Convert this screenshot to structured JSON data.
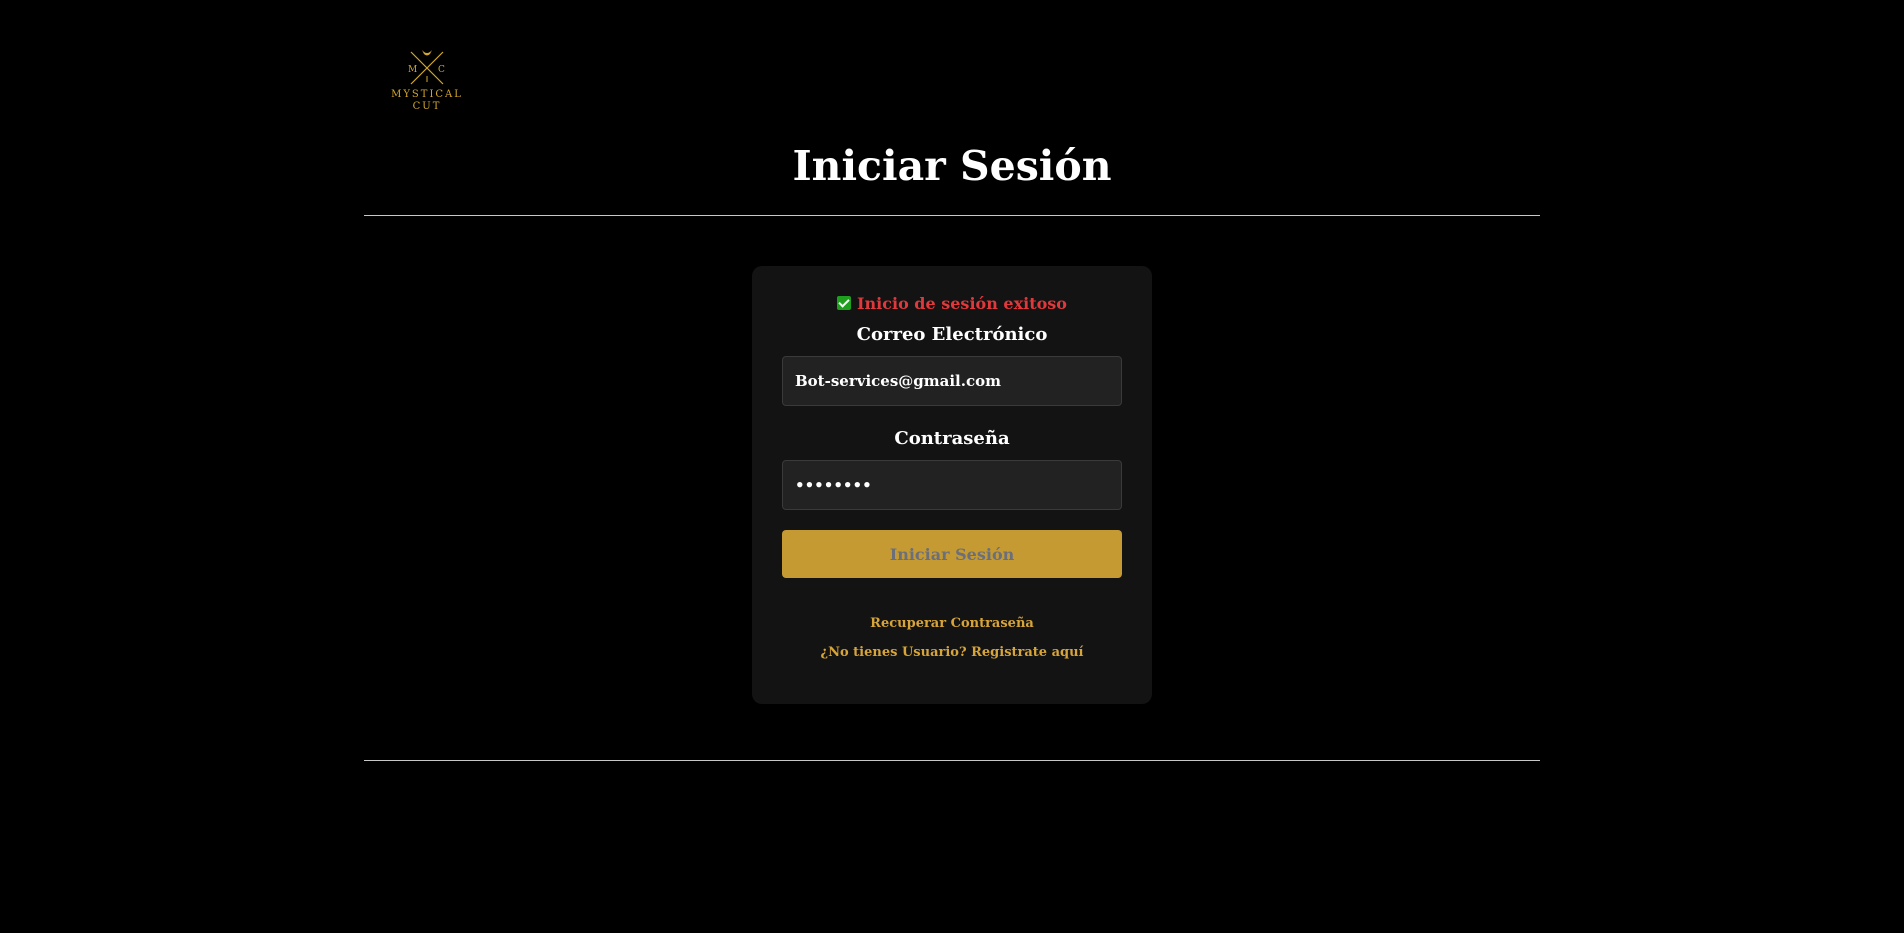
{
  "brand": {
    "logo_letters": [
      "M",
      "C"
    ],
    "logo_name_line1": "MYSTICAL",
    "logo_name_line2": "CUT",
    "accent_color": "#d4a72c"
  },
  "page": {
    "title": "Iniciar Sesión"
  },
  "login_form": {
    "status_message": "Inicio de sesión exitoso",
    "status_icon": "check-icon",
    "email_label": "Correo Electrónico",
    "email_value": "Bot-services@gmail.com",
    "password_label": "Contraseña",
    "password_value": "••••••••",
    "submit_label": "Iniciar Sesión",
    "submit_color": "#c59a33",
    "recover_link": "Recuperar Contraseña",
    "register_link": "¿No tienes Usuario? Registrate aquí"
  }
}
